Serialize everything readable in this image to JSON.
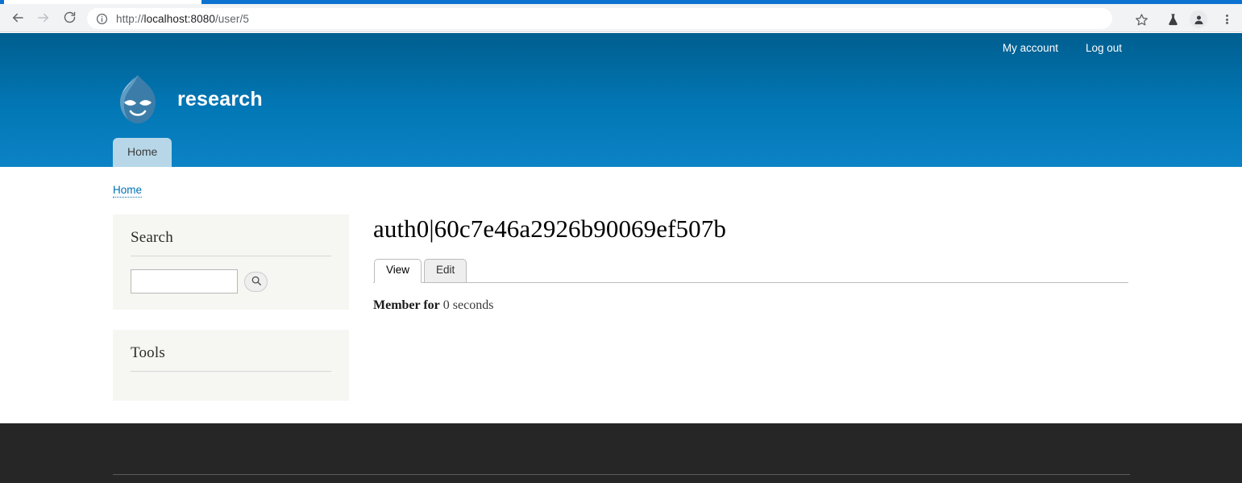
{
  "browser": {
    "back_icon": "arrow-left-icon",
    "forward_icon": "arrow-right-icon",
    "reload_icon": "reload-icon",
    "info_icon": "site-info-icon",
    "url_scheme": "http://",
    "url_host": "localhost:8080",
    "url_path": "/user/5",
    "url_full": "http://localhost:8080/user/5",
    "star_icon": "bookmark-star-icon",
    "flask_icon": "experiments-flask-icon",
    "profile_icon": "profile-avatar-icon",
    "menu_icon": "three-dot-menu-icon"
  },
  "header": {
    "site_name": "research",
    "logo_icon": "drupal-droplet-logo",
    "user_links": [
      {
        "label": "My account"
      },
      {
        "label": "Log out"
      }
    ],
    "main_menu": [
      {
        "label": "Home"
      }
    ],
    "gradient_top": "#005e8f",
    "gradient_bottom": "#0c83c6",
    "tab_bg": "#b7d7e8"
  },
  "breadcrumb": {
    "items": [
      {
        "label": "Home"
      }
    ],
    "link_color": "#0071b3"
  },
  "sidebar": {
    "blocks": [
      {
        "title": "Search",
        "search_value": "",
        "search_placeholder": "",
        "search_button_icon": "search-magnifier-icon"
      },
      {
        "title": "Tools"
      }
    ],
    "block_bg": "#f6f6f2"
  },
  "main": {
    "page_title": "auth0|60c7e46a2926b90069ef507b",
    "tabs": [
      {
        "label": "View",
        "active": true
      },
      {
        "label": "Edit",
        "active": false
      }
    ],
    "member_label": "Member for",
    "member_value": "0 seconds"
  },
  "footer": {
    "background": "#262626"
  }
}
